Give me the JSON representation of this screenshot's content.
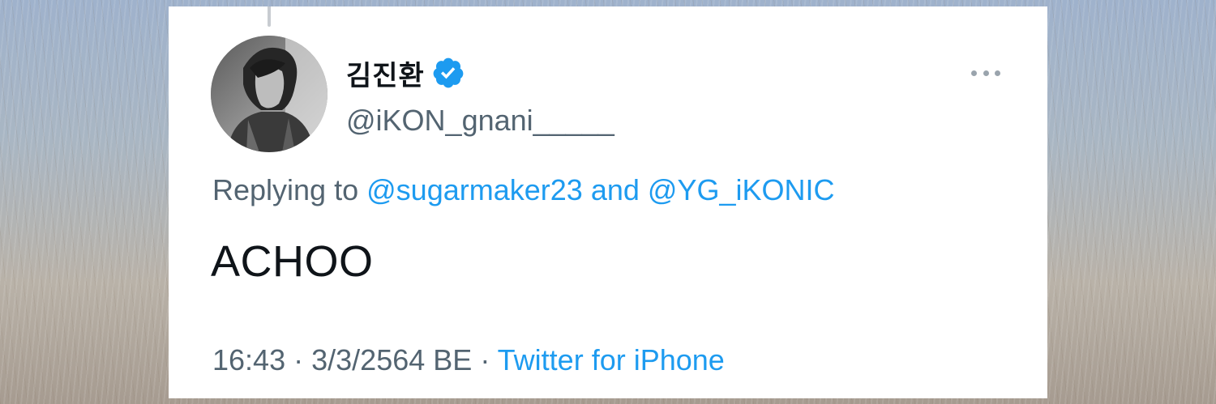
{
  "tweet": {
    "author": {
      "display_name": "김진환",
      "handle": "@iKON_gnani_____",
      "verified": true,
      "verified_icon": "verified-badge-icon"
    },
    "menu_icon": "more-options-icon",
    "replying_to": {
      "prefix": "Replying to",
      "user1": "@sugarmaker23",
      "conjunction": "and",
      "user2": "@YG_iKONIC"
    },
    "text": "ACHOO",
    "time": "16:43",
    "separator": "·",
    "date": "3/3/2564 BE",
    "source": "Twitter for iPhone"
  },
  "colors": {
    "link": "#1d9bf0",
    "muted": "#536471",
    "text": "#0f1419",
    "card_background": "#ffffff"
  }
}
